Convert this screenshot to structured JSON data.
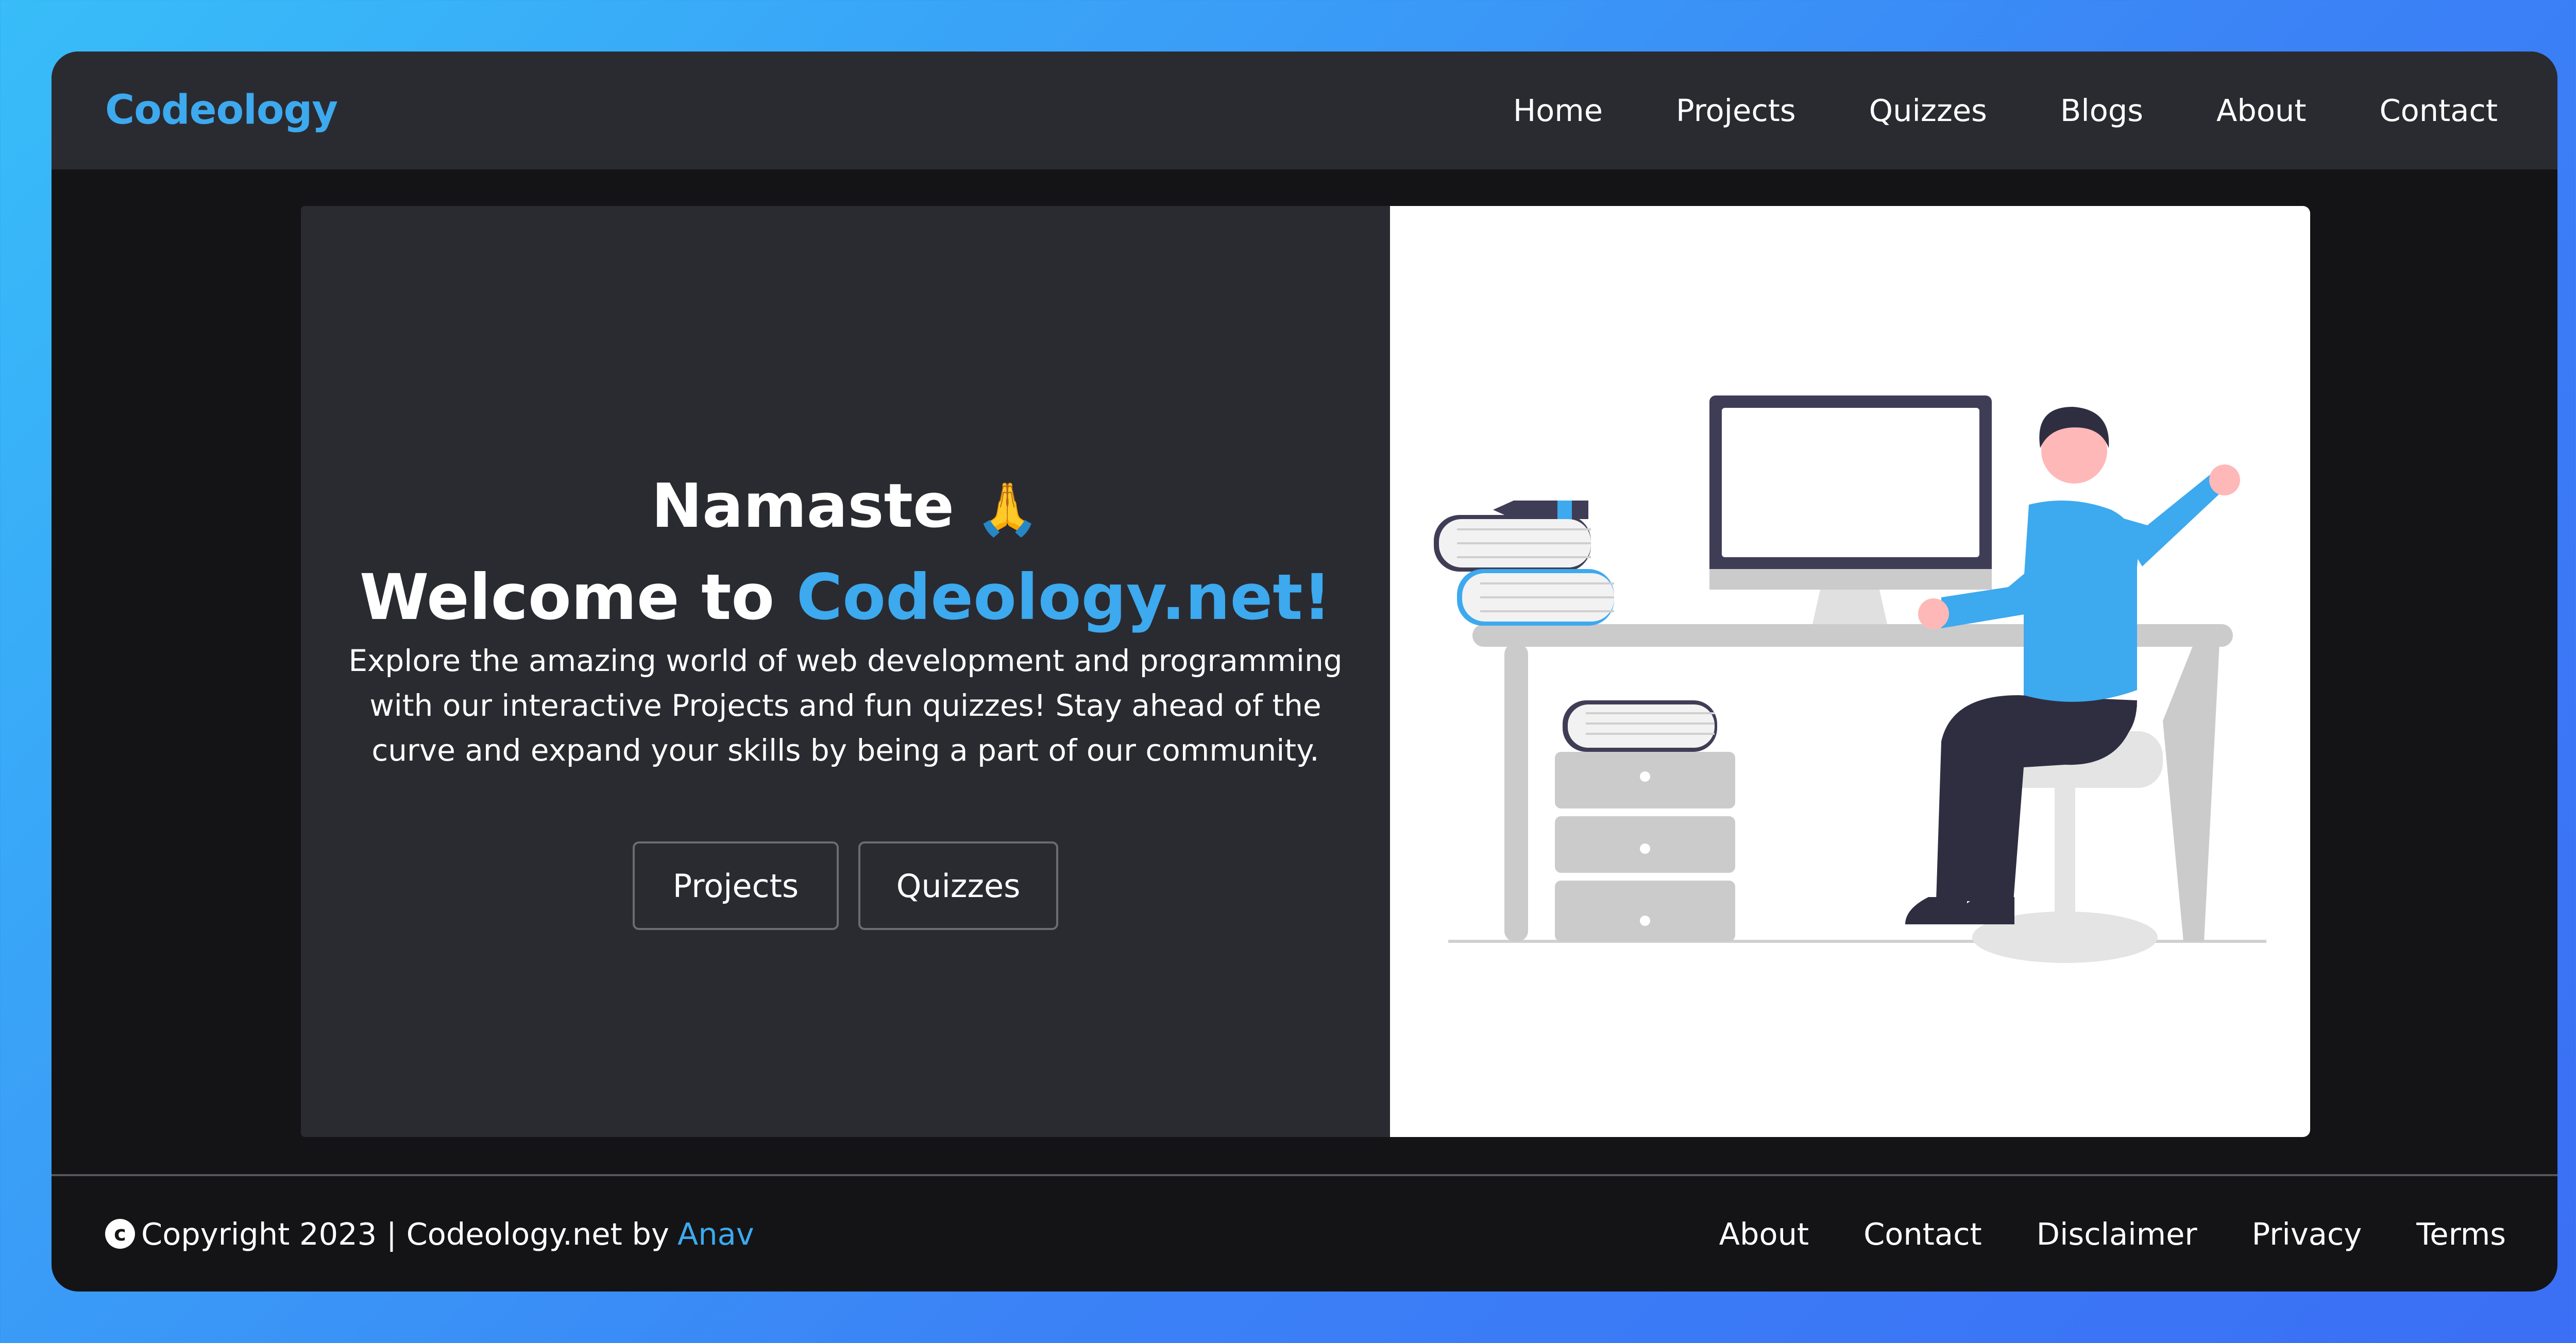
{
  "navbar": {
    "brand": "Codeology",
    "links": [
      "Home",
      "Projects",
      "Quizzes",
      "Blogs",
      "About",
      "Contact"
    ]
  },
  "hero": {
    "greeting": "Namaste",
    "greeting_emoji": "🙏",
    "welcome_prefix": "Welcome to",
    "welcome_site": "Codeology.net!",
    "description": "Explore the amazing world of web development and programming with our interactive Projects and fun quizzes! Stay ahead of the curve and expand your skills by being a part of our community.",
    "buttons": {
      "projects": "Projects",
      "quizzes": "Quizzes"
    },
    "illustration": "person-at-desk-illustration"
  },
  "footer": {
    "copyright_symbol": "c",
    "copyright_text": "Copyright 2023 | Codeology.net by",
    "author": "Anav",
    "links": [
      "About",
      "Contact",
      "Disclaimer",
      "Privacy",
      "Terms"
    ]
  },
  "colors": {
    "accent": "#3da9ee",
    "background_gradient_start": "#38bdf8",
    "background_gradient_end": "#3b6ff5",
    "window_bg": "#141416",
    "card_bg": "#2a2b31"
  },
  "icons": {
    "greeting_icon": "folded-hands-icon",
    "copyright_icon": "copyright-icon"
  }
}
